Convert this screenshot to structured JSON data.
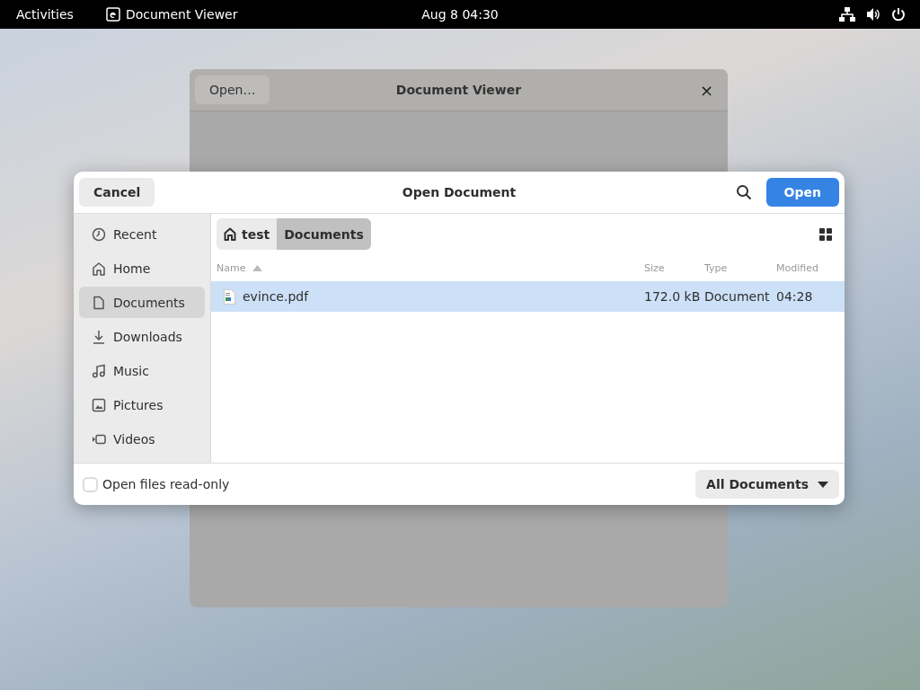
{
  "top_bar": {
    "activities": "Activities",
    "app_name": "Document Viewer",
    "clock": "Aug 8  04:30"
  },
  "back_window": {
    "title": "Document Viewer",
    "open_button": "Open…",
    "close": "×"
  },
  "dialog": {
    "title": "Open Document",
    "cancel": "Cancel",
    "open": "Open",
    "sidebar": [
      {
        "label": "Recent",
        "selected": false
      },
      {
        "label": "Home",
        "selected": false
      },
      {
        "label": "Documents",
        "selected": true
      },
      {
        "label": "Downloads",
        "selected": false
      },
      {
        "label": "Music",
        "selected": false
      },
      {
        "label": "Pictures",
        "selected": false
      },
      {
        "label": "Videos",
        "selected": false
      }
    ],
    "path": [
      {
        "label": "test",
        "selected": false
      },
      {
        "label": "Documents",
        "selected": true
      }
    ],
    "columns": [
      "Name",
      "Size",
      "Type",
      "Modified"
    ],
    "rows": [
      {
        "name": "evince.pdf",
        "size": "172.0 kB",
        "type": "Document",
        "modified": "04:28",
        "selected": true
      }
    ],
    "read_only": {
      "label": "Open files read-only",
      "checked": false
    },
    "filter": "All Documents"
  }
}
